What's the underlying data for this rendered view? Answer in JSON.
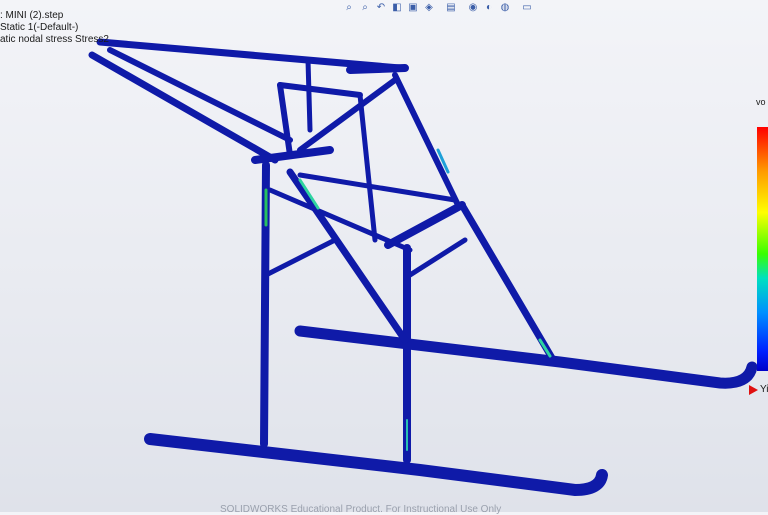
{
  "info": {
    "model_line": ": MINI (2).step",
    "study_line": " Static 1(-Default-)",
    "plot_line": "atic nodal stress Stress2"
  },
  "toolbar": {
    "icons": [
      "zoom-to-fit-icon",
      "zoom-area-icon",
      "previous-view-icon",
      "section-view-icon",
      "dynamic-annotation-icon",
      "view-orientation-icon",
      "display-style-icon",
      "hide-show-icon",
      "edit-appearance-icon",
      "apply-scene-icon",
      "view-settings-icon",
      "monitor-icon"
    ]
  },
  "legend": {
    "title": "vo",
    "yield_label": "Yi",
    "colors": [
      "#ff0000",
      "#ffff00",
      "#39ff00",
      "#00e0c0",
      "#0090ff",
      "#0000c8"
    ]
  },
  "watermark": "SOLIDWORKS Educational Product. For Instructional Use Only"
}
